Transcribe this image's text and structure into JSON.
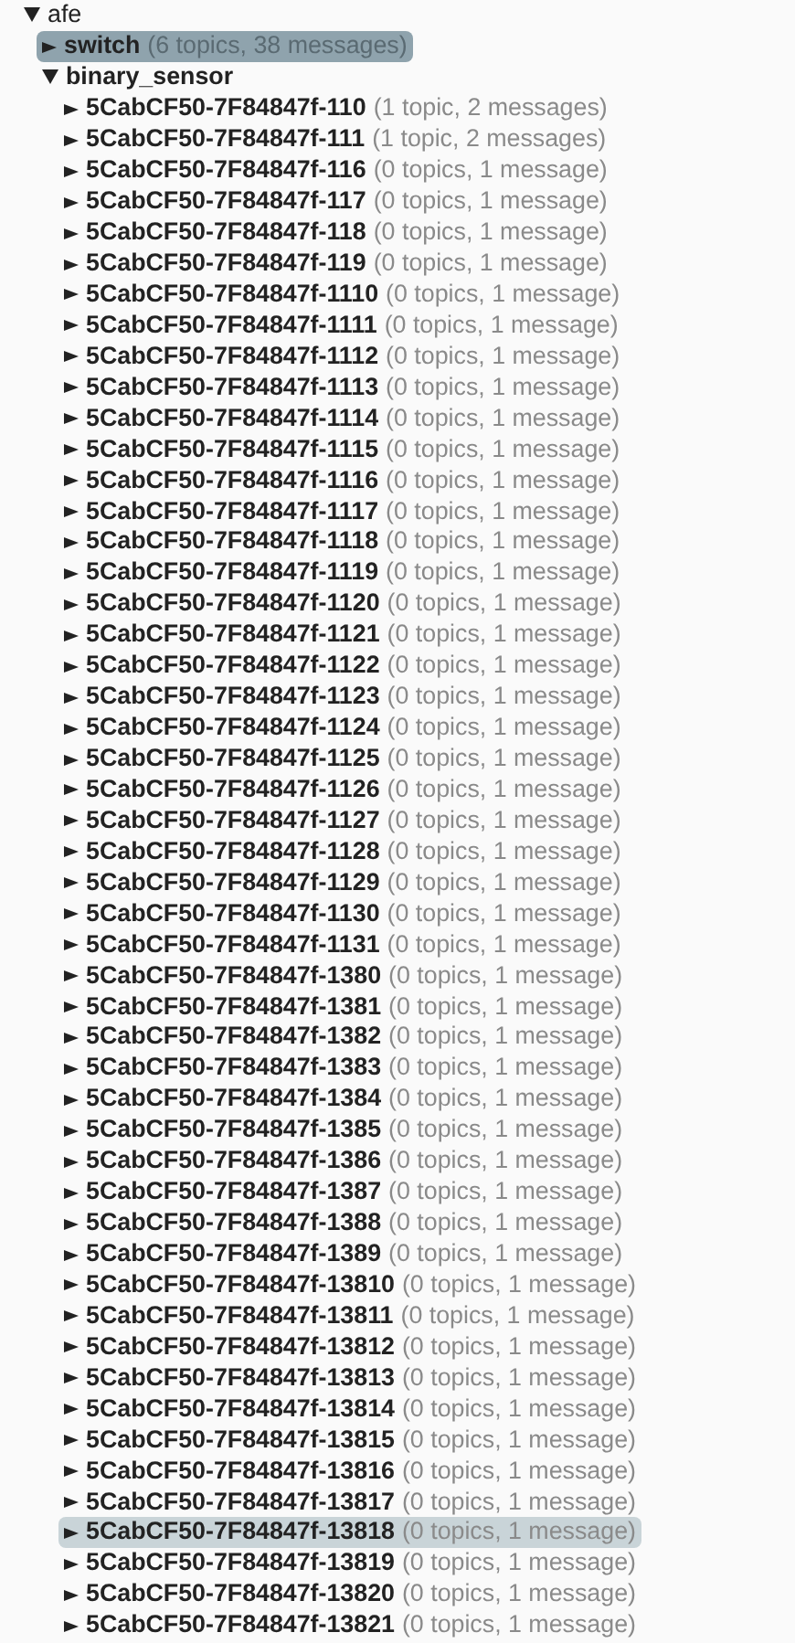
{
  "tree": [
    {
      "label": "afe",
      "expanded": true,
      "selected": false,
      "hovered": false,
      "children": [
        {
          "label": "switch",
          "summary": "(6 topics, 38 messages)",
          "expanded": false,
          "selected": true,
          "hovered": false
        },
        {
          "label": "binary_sensor",
          "expanded": true,
          "selected": false,
          "hovered": false,
          "children": [
            {
              "label": "5CabCF50-7F84847f-110",
              "summary": "(1 topic, 2 messages)",
              "expanded": false,
              "selected": false,
              "hovered": false
            },
            {
              "label": "5CabCF50-7F84847f-111",
              "summary": "(1 topic, 2 messages)",
              "expanded": false,
              "selected": false,
              "hovered": false
            },
            {
              "label": "5CabCF50-7F84847f-116",
              "summary": "(0 topics, 1 message)",
              "expanded": false,
              "selected": false,
              "hovered": false
            },
            {
              "label": "5CabCF50-7F84847f-117",
              "summary": "(0 topics, 1 message)",
              "expanded": false,
              "selected": false,
              "hovered": false
            },
            {
              "label": "5CabCF50-7F84847f-118",
              "summary": "(0 topics, 1 message)",
              "expanded": false,
              "selected": false,
              "hovered": false
            },
            {
              "label": "5CabCF50-7F84847f-119",
              "summary": "(0 topics, 1 message)",
              "expanded": false,
              "selected": false,
              "hovered": false
            },
            {
              "label": "5CabCF50-7F84847f-1110",
              "summary": "(0 topics, 1 message)",
              "expanded": false,
              "selected": false,
              "hovered": false
            },
            {
              "label": "5CabCF50-7F84847f-1111",
              "summary": "(0 topics, 1 message)",
              "expanded": false,
              "selected": false,
              "hovered": false
            },
            {
              "label": "5CabCF50-7F84847f-1112",
              "summary": "(0 topics, 1 message)",
              "expanded": false,
              "selected": false,
              "hovered": false
            },
            {
              "label": "5CabCF50-7F84847f-1113",
              "summary": "(0 topics, 1 message)",
              "expanded": false,
              "selected": false,
              "hovered": false
            },
            {
              "label": "5CabCF50-7F84847f-1114",
              "summary": "(0 topics, 1 message)",
              "expanded": false,
              "selected": false,
              "hovered": false
            },
            {
              "label": "5CabCF50-7F84847f-1115",
              "summary": "(0 topics, 1 message)",
              "expanded": false,
              "selected": false,
              "hovered": false
            },
            {
              "label": "5CabCF50-7F84847f-1116",
              "summary": "(0 topics, 1 message)",
              "expanded": false,
              "selected": false,
              "hovered": false
            },
            {
              "label": "5CabCF50-7F84847f-1117",
              "summary": "(0 topics, 1 message)",
              "expanded": false,
              "selected": false,
              "hovered": false
            },
            {
              "label": "5CabCF50-7F84847f-1118",
              "summary": "(0 topics, 1 message)",
              "expanded": false,
              "selected": false,
              "hovered": false
            },
            {
              "label": "5CabCF50-7F84847f-1119",
              "summary": "(0 topics, 1 message)",
              "expanded": false,
              "selected": false,
              "hovered": false
            },
            {
              "label": "5CabCF50-7F84847f-1120",
              "summary": "(0 topics, 1 message)",
              "expanded": false,
              "selected": false,
              "hovered": false
            },
            {
              "label": "5CabCF50-7F84847f-1121",
              "summary": "(0 topics, 1 message)",
              "expanded": false,
              "selected": false,
              "hovered": false
            },
            {
              "label": "5CabCF50-7F84847f-1122",
              "summary": "(0 topics, 1 message)",
              "expanded": false,
              "selected": false,
              "hovered": false
            },
            {
              "label": "5CabCF50-7F84847f-1123",
              "summary": "(0 topics, 1 message)",
              "expanded": false,
              "selected": false,
              "hovered": false
            },
            {
              "label": "5CabCF50-7F84847f-1124",
              "summary": "(0 topics, 1 message)",
              "expanded": false,
              "selected": false,
              "hovered": false
            },
            {
              "label": "5CabCF50-7F84847f-1125",
              "summary": "(0 topics, 1 message)",
              "expanded": false,
              "selected": false,
              "hovered": false
            },
            {
              "label": "5CabCF50-7F84847f-1126",
              "summary": "(0 topics, 1 message)",
              "expanded": false,
              "selected": false,
              "hovered": false
            },
            {
              "label": "5CabCF50-7F84847f-1127",
              "summary": "(0 topics, 1 message)",
              "expanded": false,
              "selected": false,
              "hovered": false
            },
            {
              "label": "5CabCF50-7F84847f-1128",
              "summary": "(0 topics, 1 message)",
              "expanded": false,
              "selected": false,
              "hovered": false
            },
            {
              "label": "5CabCF50-7F84847f-1129",
              "summary": "(0 topics, 1 message)",
              "expanded": false,
              "selected": false,
              "hovered": false
            },
            {
              "label": "5CabCF50-7F84847f-1130",
              "summary": "(0 topics, 1 message)",
              "expanded": false,
              "selected": false,
              "hovered": false
            },
            {
              "label": "5CabCF50-7F84847f-1131",
              "summary": "(0 topics, 1 message)",
              "expanded": false,
              "selected": false,
              "hovered": false
            },
            {
              "label": "5CabCF50-7F84847f-1380",
              "summary": "(0 topics, 1 message)",
              "expanded": false,
              "selected": false,
              "hovered": false
            },
            {
              "label": "5CabCF50-7F84847f-1381",
              "summary": "(0 topics, 1 message)",
              "expanded": false,
              "selected": false,
              "hovered": false
            },
            {
              "label": "5CabCF50-7F84847f-1382",
              "summary": "(0 topics, 1 message)",
              "expanded": false,
              "selected": false,
              "hovered": false
            },
            {
              "label": "5CabCF50-7F84847f-1383",
              "summary": "(0 topics, 1 message)",
              "expanded": false,
              "selected": false,
              "hovered": false
            },
            {
              "label": "5CabCF50-7F84847f-1384",
              "summary": "(0 topics, 1 message)",
              "expanded": false,
              "selected": false,
              "hovered": false
            },
            {
              "label": "5CabCF50-7F84847f-1385",
              "summary": "(0 topics, 1 message)",
              "expanded": false,
              "selected": false,
              "hovered": false
            },
            {
              "label": "5CabCF50-7F84847f-1386",
              "summary": "(0 topics, 1 message)",
              "expanded": false,
              "selected": false,
              "hovered": false
            },
            {
              "label": "5CabCF50-7F84847f-1387",
              "summary": "(0 topics, 1 message)",
              "expanded": false,
              "selected": false,
              "hovered": false
            },
            {
              "label": "5CabCF50-7F84847f-1388",
              "summary": "(0 topics, 1 message)",
              "expanded": false,
              "selected": false,
              "hovered": false
            },
            {
              "label": "5CabCF50-7F84847f-1389",
              "summary": "(0 topics, 1 message)",
              "expanded": false,
              "selected": false,
              "hovered": false
            },
            {
              "label": "5CabCF50-7F84847f-13810",
              "summary": "(0 topics, 1 message)",
              "expanded": false,
              "selected": false,
              "hovered": false
            },
            {
              "label": "5CabCF50-7F84847f-13811",
              "summary": "(0 topics, 1 message)",
              "expanded": false,
              "selected": false,
              "hovered": false
            },
            {
              "label": "5CabCF50-7F84847f-13812",
              "summary": "(0 topics, 1 message)",
              "expanded": false,
              "selected": false,
              "hovered": false
            },
            {
              "label": "5CabCF50-7F84847f-13813",
              "summary": "(0 topics, 1 message)",
              "expanded": false,
              "selected": false,
              "hovered": false
            },
            {
              "label": "5CabCF50-7F84847f-13814",
              "summary": "(0 topics, 1 message)",
              "expanded": false,
              "selected": false,
              "hovered": false
            },
            {
              "label": "5CabCF50-7F84847f-13815",
              "summary": "(0 topics, 1 message)",
              "expanded": false,
              "selected": false,
              "hovered": false
            },
            {
              "label": "5CabCF50-7F84847f-13816",
              "summary": "(0 topics, 1 message)",
              "expanded": false,
              "selected": false,
              "hovered": false
            },
            {
              "label": "5CabCF50-7F84847f-13817",
              "summary": "(0 topics, 1 message)",
              "expanded": false,
              "selected": false,
              "hovered": false
            },
            {
              "label": "5CabCF50-7F84847f-13818",
              "summary": "(0 topics, 1 message)",
              "expanded": false,
              "selected": false,
              "hovered": true
            },
            {
              "label": "5CabCF50-7F84847f-13819",
              "summary": "(0 topics, 1 message)",
              "expanded": false,
              "selected": false,
              "hovered": false
            },
            {
              "label": "5CabCF50-7F84847f-13820",
              "summary": "(0 topics, 1 message)",
              "expanded": false,
              "selected": false,
              "hovered": false
            },
            {
              "label": "5CabCF50-7F84847f-13821",
              "summary": "(0 topics, 1 message)",
              "expanded": false,
              "selected": false,
              "hovered": false
            }
          ]
        }
      ]
    }
  ]
}
